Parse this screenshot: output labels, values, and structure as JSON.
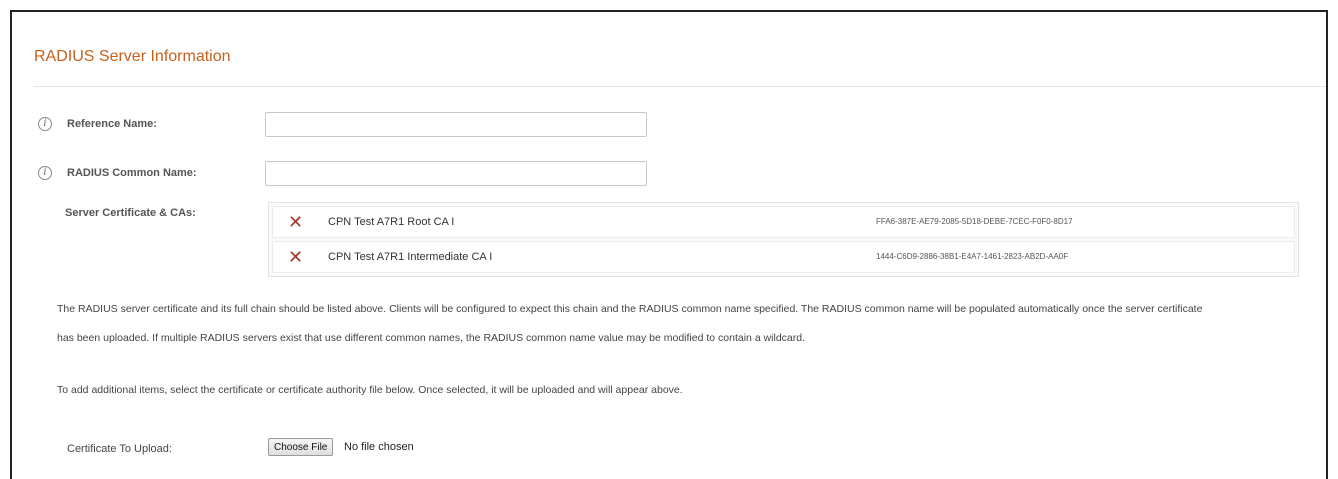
{
  "panel": {
    "title": "RADIUS Server Information"
  },
  "fields": {
    "reference_name": {
      "label": "Reference Name:",
      "value": ""
    },
    "radius_common_name": {
      "label": "RADIUS Common Name:",
      "value": ""
    },
    "server_certs": {
      "label": "Server Certificate & CAs:"
    }
  },
  "certificates": [
    {
      "name": "CPN Test A7R1 Root CA I",
      "id": "FFA6-387E-AE79-2085-5D18-DEBE-7CEC-F0F0-8D17",
      "remove_icon": "close-icon"
    },
    {
      "name": "CPN Test A7R1 Intermediate CA I",
      "id": "1444-C6D9-2886-38B1-E4A7-1461-2823-AB2D-AA0F",
      "remove_icon": "close-icon"
    }
  ],
  "description": {
    "line1": "The RADIUS server certificate and its full chain should be listed above. Clients will be configured to expect this chain and the RADIUS common name specified. The RADIUS common name will be populated automatically once the server certificate",
    "line2": "has been uploaded. If multiple RADIUS servers exist that use different common names, the RADIUS common name value may be modified to contain a wildcard.",
    "additional": "To add additional items, select the certificate or certificate authority file below. Once selected, it will be uploaded and will appear above."
  },
  "upload": {
    "label": "Certificate To Upload:",
    "button_label": "Choose File",
    "status": "No file chosen"
  },
  "colors": {
    "header": "#c7611d",
    "remove_icon": "#a33a2c"
  }
}
